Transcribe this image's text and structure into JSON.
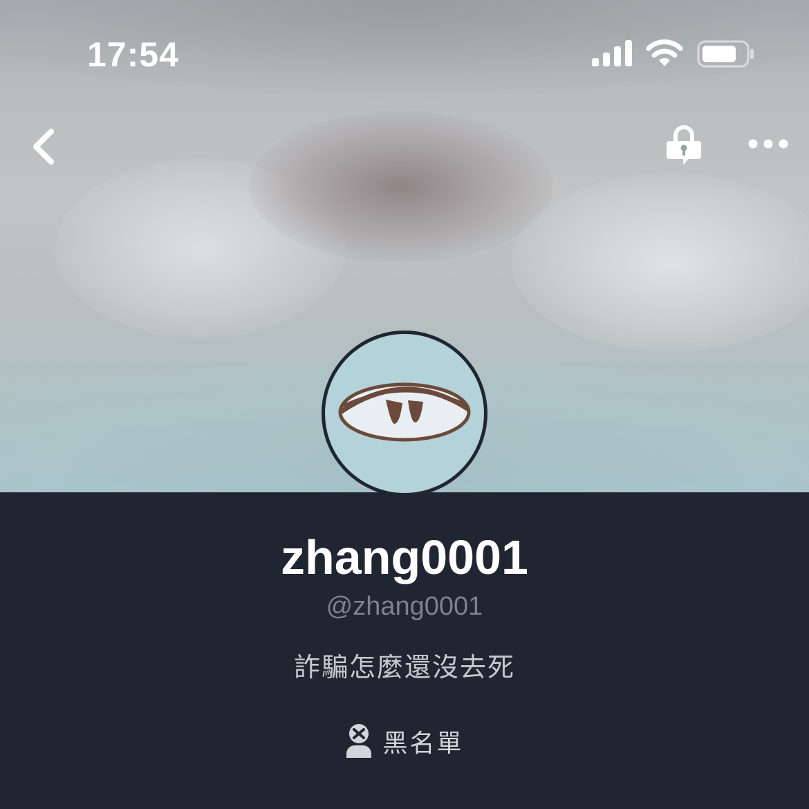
{
  "status_bar": {
    "time": "17:54",
    "signal_icon": "cellular-signal-icon",
    "wifi_icon": "wifi-icon",
    "battery_icon": "battery-icon"
  },
  "nav": {
    "back_icon": "chevron-left-icon",
    "privacy_icon": "lock-chat-icon",
    "more_icon": "ellipsis-icon"
  },
  "profile": {
    "display_name": "zhang0001",
    "handle": "@zhang0001",
    "status_message": "詐騙怎麼還沒去死",
    "avatar_icon": "sleepy-eye-avatar"
  },
  "actions": {
    "blocklist_label": "黑名單",
    "blocklist_icon": "user-blocked-icon"
  },
  "colors": {
    "panel_background": "#1f2531",
    "name_text": "#ffffff",
    "handle_text": "#7d828b",
    "status_text": "#c6c9cf",
    "avatar_background": "#b3d2da"
  }
}
